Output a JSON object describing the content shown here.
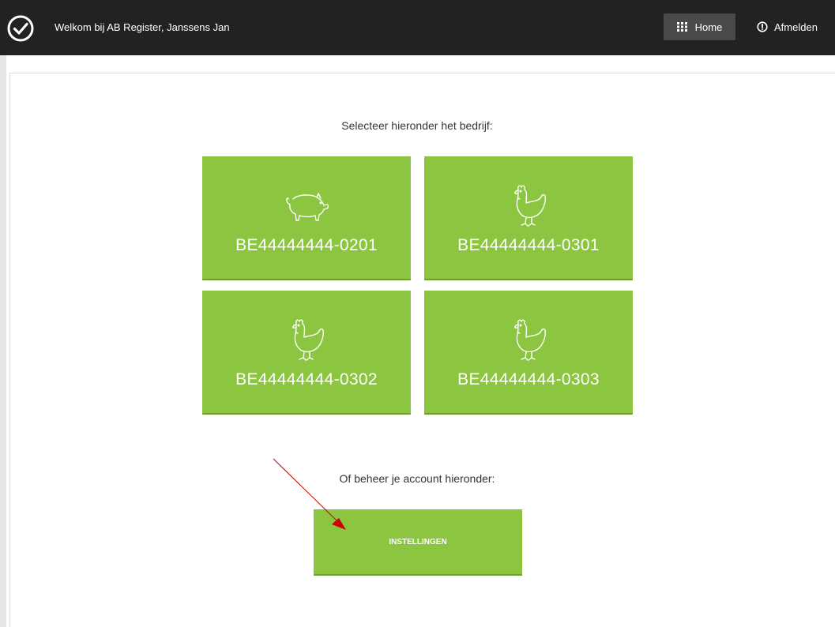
{
  "header": {
    "welcome_text": "Welkom bij AB Register, Janssens Jan",
    "home_label": "Home",
    "logout_label": "Afmelden"
  },
  "main": {
    "select_prompt": "Selecteer hieronder het bedrijf:",
    "companies": [
      {
        "code": "BE44444444-0201",
        "animal_icon": "pig-icon"
      },
      {
        "code": "BE44444444-0301",
        "animal_icon": "chicken-icon"
      },
      {
        "code": "BE44444444-0302",
        "animal_icon": "chicken-icon"
      },
      {
        "code": "BE44444444-0303",
        "animal_icon": "chicken-icon"
      }
    ],
    "account_prompt": "Of beheer je account hieronder:",
    "settings_label": "INSTELLINGEN"
  },
  "colors": {
    "topbar": "#222222",
    "tile_green": "#8cc540",
    "annotation_arrow": "#cc0000"
  }
}
